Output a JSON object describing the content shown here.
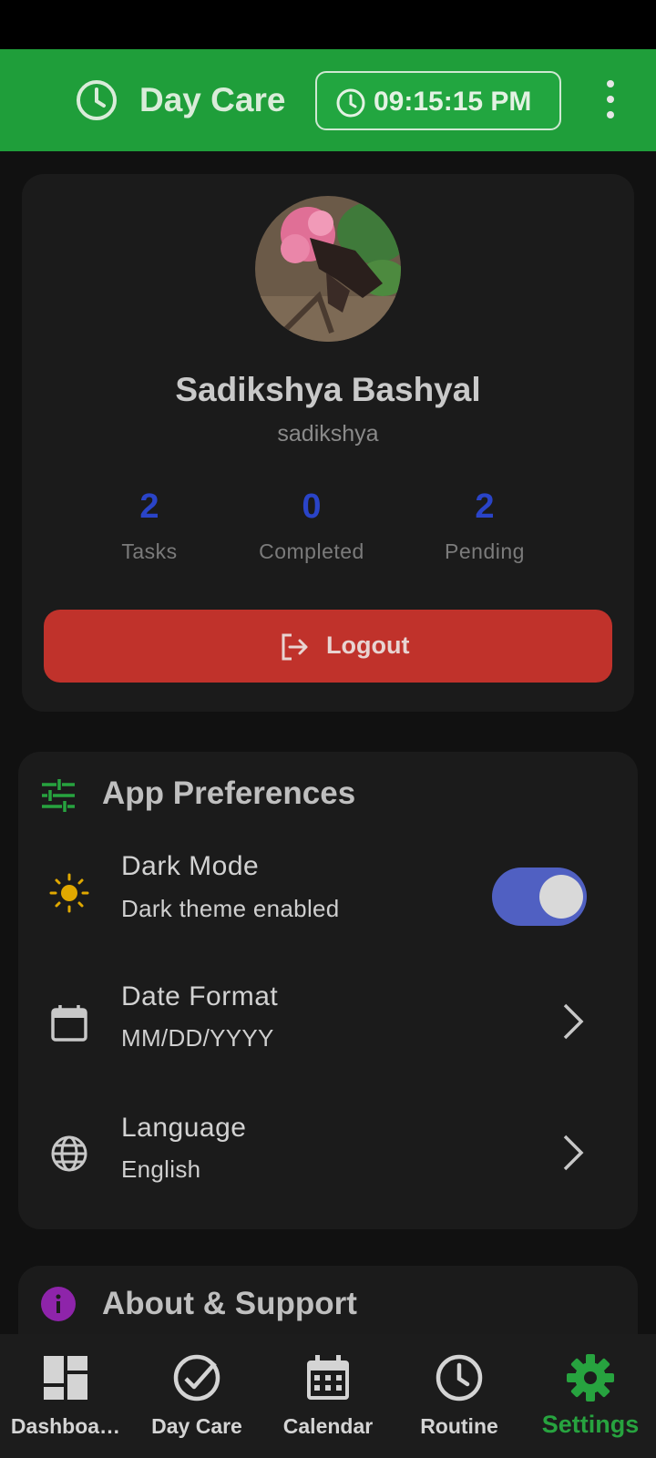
{
  "app_bar": {
    "title": "Day Care",
    "time": "09:15:15 PM",
    "icons": {
      "title": "clock-icon",
      "time": "clock-icon",
      "menu": "more-vertical-icon"
    }
  },
  "profile": {
    "name": "Sadikshya Bashyal",
    "username": "sadikshya",
    "avatar_description": "butterfly-on-flower-photo",
    "stats": [
      {
        "value": "2",
        "label": "Tasks"
      },
      {
        "value": "0",
        "label": "Completed"
      },
      {
        "value": "2",
        "label": "Pending"
      }
    ],
    "logout_label": "Logout"
  },
  "preferences": {
    "title": "App Preferences",
    "items": [
      {
        "title": "Dark Mode",
        "subtitle": "Dark theme enabled",
        "icon": "sun-icon",
        "control": "toggle",
        "on": true
      },
      {
        "title": "Date Format",
        "subtitle": "MM/DD/YYYY",
        "icon": "calendar-icon",
        "control": "chevron"
      },
      {
        "title": "Language",
        "subtitle": "English",
        "icon": "globe-icon",
        "control": "chevron"
      }
    ]
  },
  "about": {
    "title": "About & Support",
    "icon": "info-icon"
  },
  "bottom_nav": {
    "items": [
      {
        "label": "Dashboa…",
        "icon": "dashboard-icon"
      },
      {
        "label": "Day Care",
        "icon": "check-circle-icon"
      },
      {
        "label": "Calendar",
        "icon": "calendar-icon"
      },
      {
        "label": "Routine",
        "icon": "clock-icon"
      },
      {
        "label": "Settings",
        "icon": "gear-icon",
        "active": true
      }
    ]
  },
  "colors": {
    "app_bar": "#1f9e3a",
    "stat_value": "#2a44c8",
    "logout": "#c0322b",
    "toggle": "#5060c2",
    "nav_active": "#27a33f",
    "sun": "#e0a800",
    "info": "#8e24aa"
  }
}
